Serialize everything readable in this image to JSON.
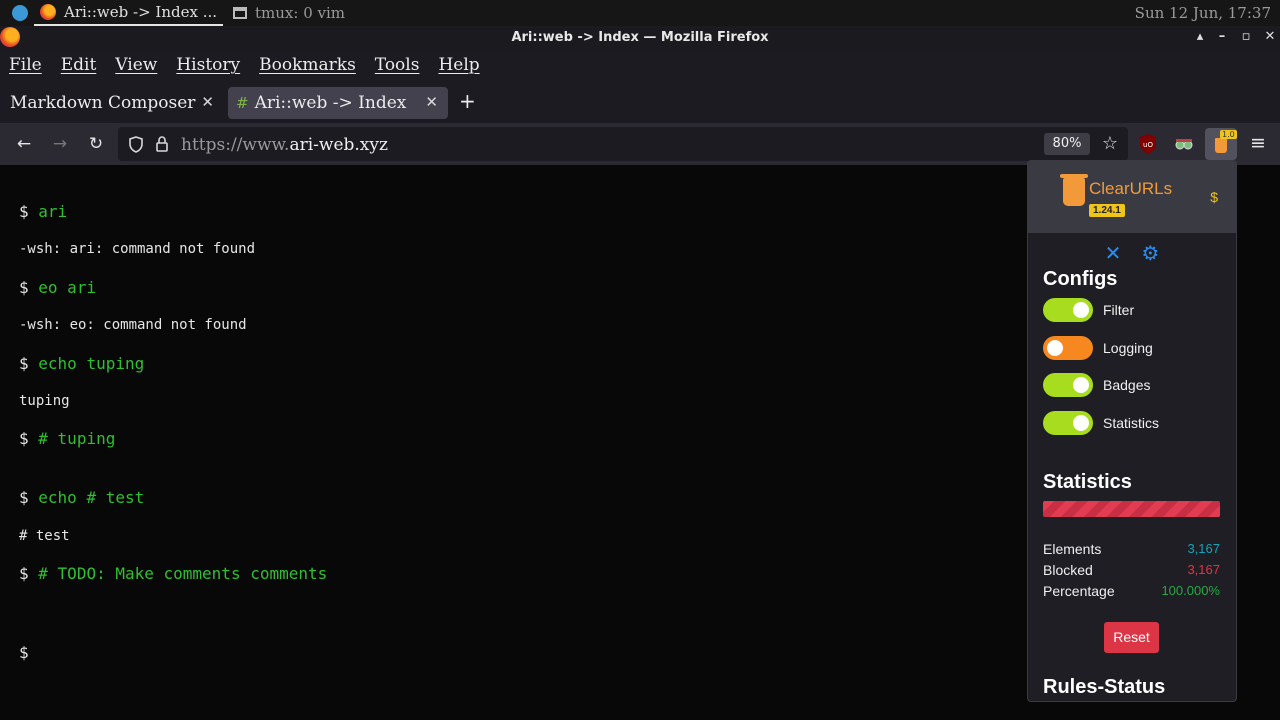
{
  "system_panel": {
    "apps": [
      {
        "title": "Ari::web -> Index ...",
        "active": true
      },
      {
        "title": "tmux: 0 vim",
        "active": false
      }
    ],
    "clock": "Sun 12 Jun, 17:37"
  },
  "window": {
    "title": "Ari::web -> Index — Mozilla Firefox",
    "controls": [
      "▴",
      "–",
      "▫",
      "✕"
    ]
  },
  "menu": [
    "File",
    "Edit",
    "View",
    "History",
    "Bookmarks",
    "Tools",
    "Help"
  ],
  "tabs": [
    {
      "label": "Markdown Composer",
      "active": false
    },
    {
      "label": "Ari::web -> Index",
      "active": true
    }
  ],
  "new_tab": "+",
  "nav": {
    "back": "←",
    "forward": "→",
    "reload": "↻",
    "url_prefix": "https://www.",
    "url_domain": "ari-web.xyz",
    "zoom": "80%",
    "badge": "1.0",
    "menu": "≡"
  },
  "terminal": [
    {
      "type": "prompt",
      "sign": "$",
      "cmd": "ari"
    },
    {
      "type": "output",
      "text": "-wsh: ari: command not found"
    },
    {
      "type": "prompt",
      "sign": "$",
      "cmd": "eo ari"
    },
    {
      "type": "output",
      "text": "-wsh: eo: command not found"
    },
    {
      "type": "prompt",
      "sign": "$",
      "cmd": "echo tuping"
    },
    {
      "type": "output",
      "text": "tuping"
    },
    {
      "type": "prompt",
      "sign": "$",
      "cmd": "# tuping"
    },
    {
      "type": "prompt",
      "sign": "$",
      "cmd": "echo # test"
    },
    {
      "type": "output",
      "text": "# test"
    },
    {
      "type": "prompt",
      "sign": "$",
      "cmd": "# TODO: Make comments comments"
    },
    {
      "type": "prompt",
      "sign": "$",
      "cmd": ""
    }
  ],
  "popup": {
    "brand": "ClearURLs",
    "version": "1.24.1",
    "donate_icon": "$",
    "configs_heading": "Configs",
    "toggles": [
      {
        "label": "Filter",
        "on": true
      },
      {
        "label": "Logging",
        "on": false
      },
      {
        "label": "Badges",
        "on": true
      },
      {
        "label": "Statistics",
        "on": true
      }
    ],
    "statistics_heading": "Statistics",
    "blocked_fraction": 1.0,
    "stats": [
      {
        "label": "Elements",
        "value": "3,167",
        "color": "#17a2b8"
      },
      {
        "label": "Blocked",
        "value": "3,167",
        "color": "#dc3545"
      },
      {
        "label": "Percentage",
        "value": "100.000%",
        "color": "#28a745"
      }
    ],
    "reset_label": "Reset",
    "rules_heading": "Rules-Status"
  }
}
